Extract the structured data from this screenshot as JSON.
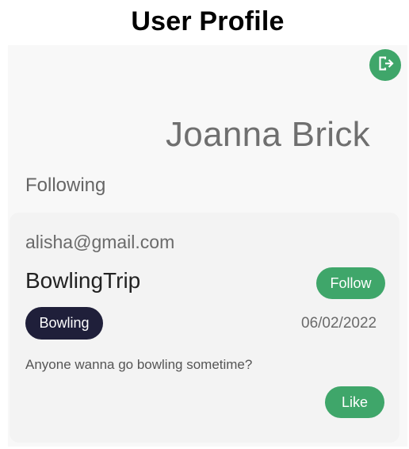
{
  "header": {
    "title": "User Profile"
  },
  "profile": {
    "name": "Joanna Brick",
    "logout_icon": "logout-icon"
  },
  "following": {
    "label": "Following",
    "posts": [
      {
        "email": "alisha@gmail.com",
        "title": "BowlingTrip",
        "follow_label": "Follow",
        "tag": "Bowling",
        "date": "06/02/2022",
        "body": "Anyone wanna go bowling sometime?",
        "like_label": "Like"
      }
    ]
  },
  "colors": {
    "accent": "#3fa66a",
    "tag_background": "#1f1f3a",
    "panel_background": "#f8f8f8",
    "card_background": "#f3f3f3"
  }
}
